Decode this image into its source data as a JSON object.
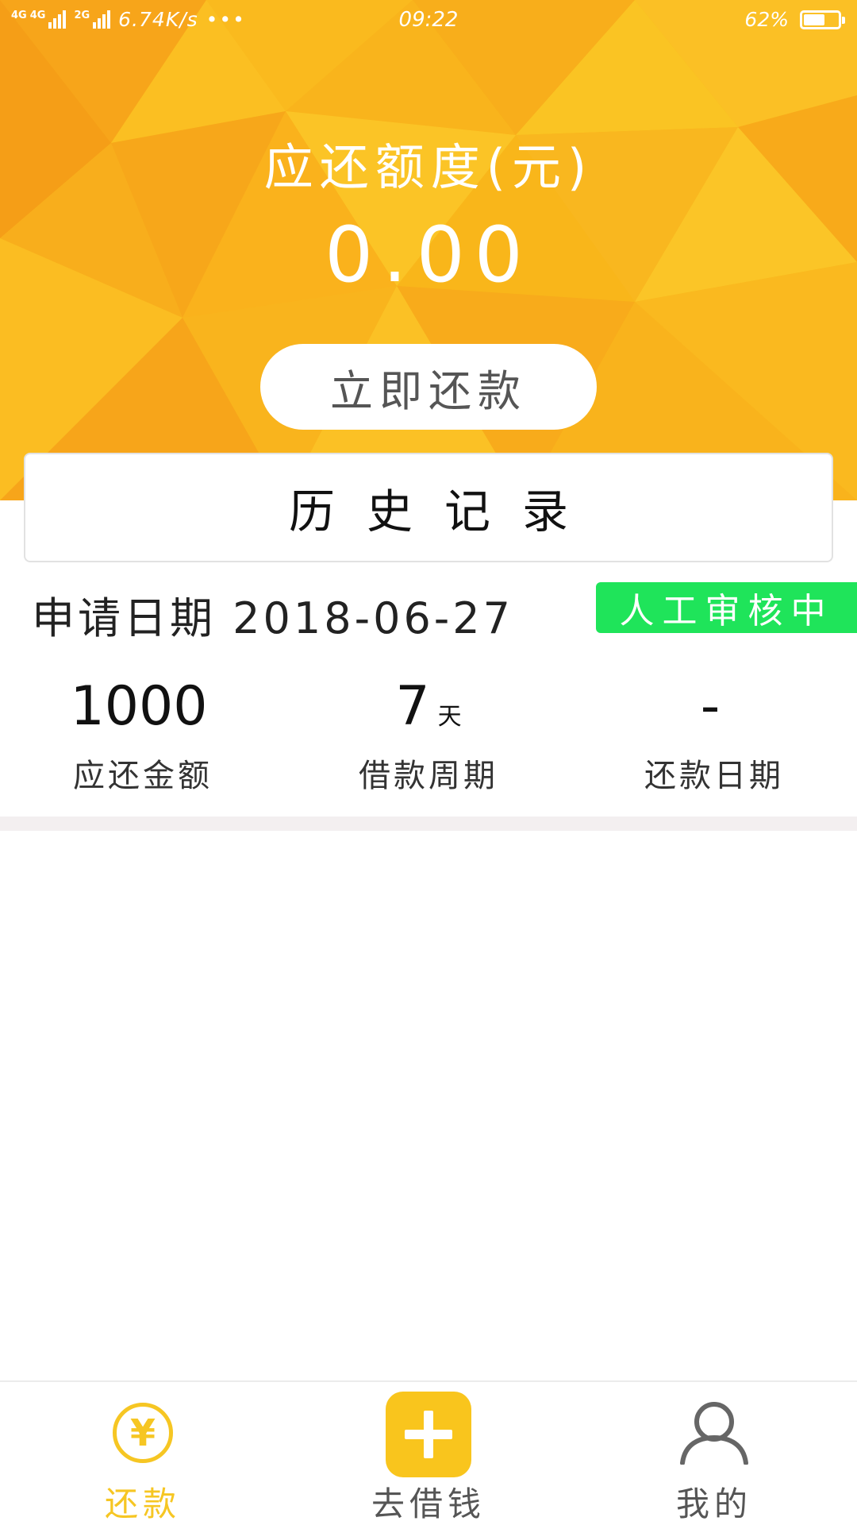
{
  "status_bar": {
    "net_left": "4G",
    "net_left2": "4G",
    "net_right": "2G",
    "speed": "6.74K/s",
    "more": "•••",
    "time": "09:22",
    "battery": "62%",
    "battery_level": 0.62
  },
  "header": {
    "quota_title": "应还额度(元)",
    "quota_amount": "0.00",
    "repay_button": "立即还款"
  },
  "history": {
    "title": "历史记录"
  },
  "record": {
    "apply_date_label": "申请日期",
    "apply_date": "2018-06-27",
    "status_tag": "人工审核中",
    "stats": [
      {
        "value": "1000",
        "unit": "",
        "label": "应还金额"
      },
      {
        "value": "7",
        "unit": "天",
        "label": "借款周期"
      },
      {
        "value": "-",
        "unit": "",
        "label": "还款日期"
      }
    ]
  },
  "bottom_nav": {
    "items": [
      {
        "label": "还款",
        "icon": "yen-coin-icon",
        "active": true
      },
      {
        "label": "去借钱",
        "icon": "plus-icon",
        "active": false
      },
      {
        "label": "我的",
        "icon": "person-icon",
        "active": false
      }
    ]
  },
  "colors": {
    "accent": "#f9b61a",
    "active_nav": "#f6c623",
    "status_tag": "#1fe45a"
  }
}
